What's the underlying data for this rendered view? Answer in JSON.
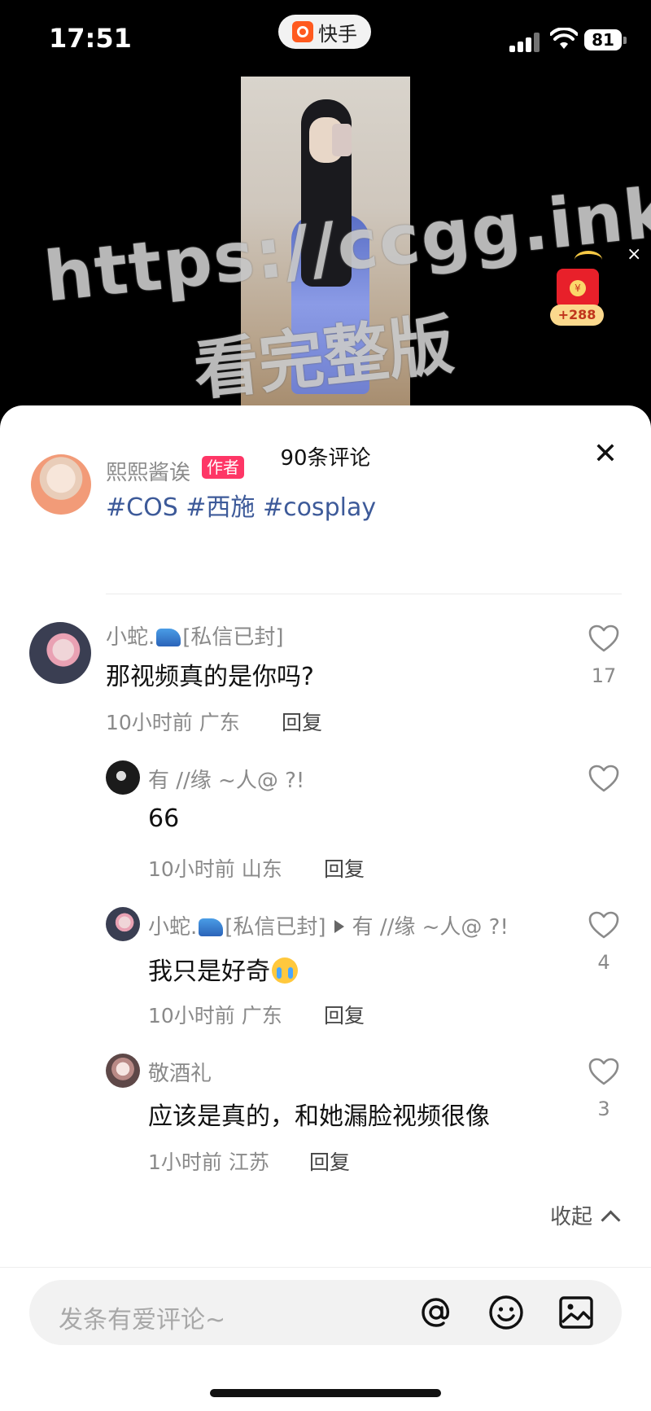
{
  "status_bar": {
    "time": "17:51",
    "app_name": "快手",
    "battery": "81"
  },
  "video": {
    "watermark_url": "https://ccgg.ink",
    "watermark_text": "看完整版",
    "red_packet_amount": "+288",
    "close_label": "×"
  },
  "sheet": {
    "title": "90条评论",
    "close_label": "✕",
    "author": {
      "name": "熙熙酱诶",
      "badge": "作者",
      "tags": "#COS #西施 #cosplay"
    },
    "comments": [
      {
        "name": "小蛇.",
        "name_suffix": "[私信已封]",
        "text": "那视频真的是你吗?",
        "time": "10小时前",
        "location": "广东",
        "reply_label": "回复",
        "likes": "17"
      },
      {
        "name": "有 //缘 ~人@ ?!",
        "text": "66",
        "time": "10小时前",
        "location": "山东",
        "reply_label": "回复",
        "likes": ""
      },
      {
        "name": "小蛇.",
        "name_suffix": "[私信已封]",
        "reply_to": "有 //缘 ~人@ ?!",
        "text": "我只是好奇",
        "time": "10小时前",
        "location": "广东",
        "reply_label": "回复",
        "likes": "4"
      },
      {
        "name": "敬酒礼",
        "text": "应该是真的，和她漏脸视频很像",
        "time": "1小时前",
        "location": "江苏",
        "reply_label": "回复",
        "likes": "3"
      }
    ],
    "collapse_label": "收起"
  },
  "composer": {
    "placeholder": "发条有爱评论~",
    "icons": [
      "at-icon",
      "emoji-icon",
      "image-icon"
    ]
  },
  "colors": {
    "badge": "#fe3666",
    "tag_link": "#3d5a99",
    "accent": "#ff5a1f"
  }
}
